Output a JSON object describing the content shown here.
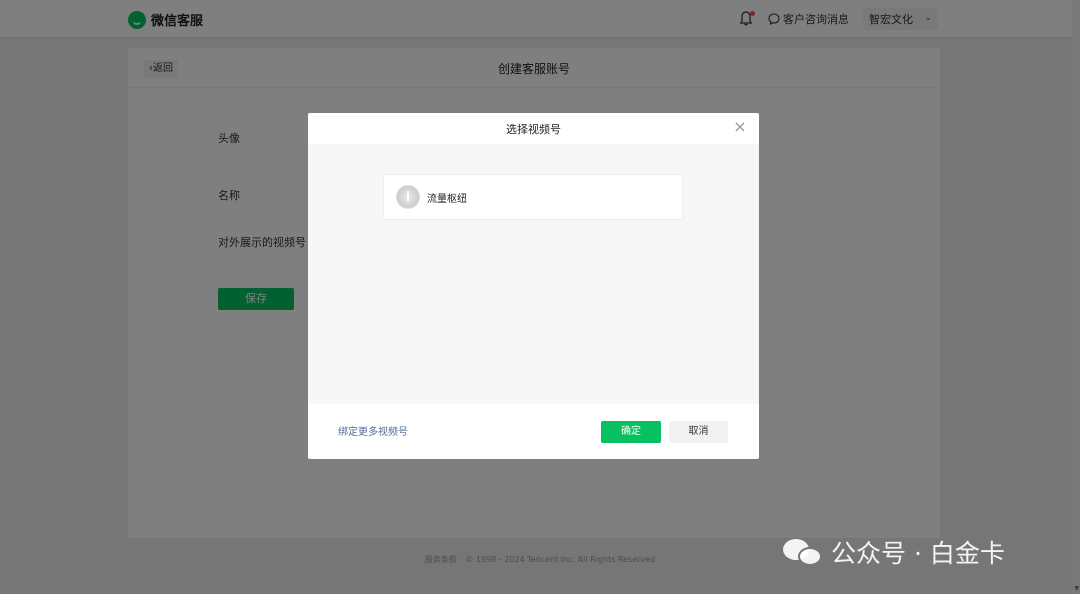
{
  "app": {
    "name": "微信客服",
    "brand_color": "#07c160",
    "logo_icon": "wechat-service-logo-icon"
  },
  "header": {
    "notification_icon": "bell-icon",
    "consult_icon": "chat-bubble-icon",
    "consult_label": "客户咨询消息",
    "account_name": "智宏文化",
    "account_caret": "chevron-down-icon"
  },
  "page": {
    "back_label": "返回",
    "title": "创建客服账号",
    "form": {
      "avatar_label": "头像",
      "name_label": "名称",
      "channel_label": "对外展示的视频号",
      "save_label": "保存"
    }
  },
  "modal": {
    "title": "选择视频号",
    "close_icon": "close-icon",
    "channels": [
      {
        "name": "流量枢纽",
        "avatar_icon": "channel-avatar-icon"
      }
    ],
    "bind_more_label": "绑定更多视频号",
    "confirm_label": "确定",
    "cancel_label": "取消"
  },
  "footer": {
    "terms": "服务条款",
    "copyright": "© 1998 - 2024 Tencent Inc. All Rights Reserved"
  },
  "watermark": {
    "text": "公众号 · 白金卡",
    "icon": "wechat-icon"
  }
}
